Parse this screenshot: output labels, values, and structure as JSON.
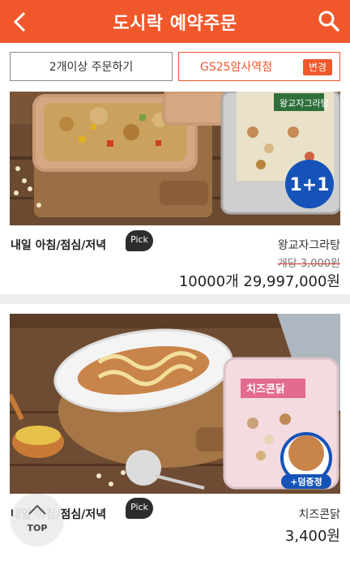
{
  "header": {
    "title": "도시락 예약주문",
    "accent_color": "#f0582c"
  },
  "options": {
    "multi_order_label": "2개이상 주문하기",
    "store_name": "GS25암사역점",
    "change_label": "변경"
  },
  "products": [
    {
      "meal_times": "내일 아침/점심/저녁",
      "pick_badge": "Pick",
      "name": "왕교자그라탕",
      "old_price": "개당 3,000원",
      "price": "10000개 29,997,000원",
      "promo_badge": "1+1",
      "package_text": "왕교자그라탕"
    },
    {
      "meal_times": "내일 아침/점심/저녁",
      "pick_badge": "Pick",
      "name": "치즈콘닭",
      "price": "3,400원",
      "promo_badge": "+덤증정",
      "package_text": "치즈콘닭"
    }
  ],
  "top_button": {
    "label": "TOP"
  }
}
